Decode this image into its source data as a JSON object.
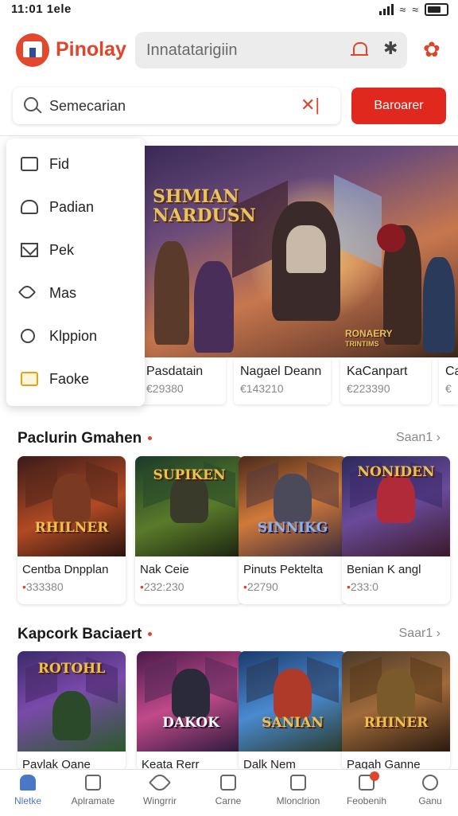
{
  "status_bar": {
    "time": "11:01 1ele"
  },
  "header": {
    "brand": "Pinolay",
    "search_text": "Innatatarigiin",
    "icons": [
      "logo-icon",
      "bell-icon",
      "asterisk-icon",
      "gear-icon"
    ]
  },
  "search": {
    "placeholder": "Semecarian",
    "button_label": "Baroarer"
  },
  "menu": {
    "items": [
      {
        "label": "Fid",
        "icon": "inbox-icon"
      },
      {
        "label": "Padian",
        "icon": "cloud-icon"
      },
      {
        "label": "Pek",
        "icon": "mail-icon"
      },
      {
        "label": "Mas",
        "icon": "tag-icon"
      },
      {
        "label": "Klppion",
        "icon": "chat-icon"
      },
      {
        "label": "Faoke",
        "icon": "folder-icon"
      }
    ]
  },
  "banner": {
    "title_line1": "SHMIAN",
    "title_line2": "NARDUSN",
    "corner_logo_line1": "RONAERY",
    "corner_logo_line2": "TRINTIMS",
    "cards": [
      {
        "name": "Pasdatain",
        "price": "€29380"
      },
      {
        "name": "Nagael Deann",
        "price": "€143210"
      },
      {
        "name": "KaCanpart",
        "price": "€223390"
      },
      {
        "name": "Ca",
        "price": "€"
      }
    ]
  },
  "section1": {
    "title": "Paclurin Gmahen",
    "see_all": "Saan1 ›",
    "cards": [
      {
        "art_title": "RHILNER",
        "name": "Centba Dnpplan",
        "price": "333380",
        "accent": "#c0502a"
      },
      {
        "art_title": "SUPIKEN",
        "name": "Nak Ceie",
        "price": "232:230",
        "accent": "#3a7a3a"
      },
      {
        "art_title": "SINNIKG",
        "name": "Pinuts Pektelta",
        "price": "22790",
        "accent": "#5a4a7a"
      },
      {
        "art_title": "NONIDEN",
        "name": "Benian K angl",
        "price": "233:0",
        "accent": "#4a5aa0"
      }
    ]
  },
  "section2": {
    "title": "Kapcork Baciaert",
    "see_all": "Saar1 ›",
    "cards": [
      {
        "art_title": "ROTOHL",
        "name": "Pavlak Oane",
        "accent": "#6a3aa0"
      },
      {
        "art_title": "DAKOK",
        "name": "Keata Rerr",
        "accent": "#a03a8a"
      },
      {
        "art_title": "SANIAN",
        "name": "Dalk Nem",
        "accent": "#2a6ab0"
      },
      {
        "art_title": "RHINER",
        "name": "Pagah Ganne",
        "accent": "#8a5a2a"
      }
    ]
  },
  "bottom_nav": {
    "items": [
      {
        "label": "Nletke",
        "icon": "home-icon",
        "active": true
      },
      {
        "label": "Aplramate",
        "icon": "apps-icon"
      },
      {
        "label": "Wingrrir",
        "icon": "rocket-icon"
      },
      {
        "label": "Carne",
        "icon": "game-icon"
      },
      {
        "label": "Mlonclrion",
        "icon": "image-icon"
      },
      {
        "label": "Feobenih",
        "icon": "notification-icon"
      },
      {
        "label": "Ganu",
        "icon": "profile-icon"
      }
    ]
  }
}
